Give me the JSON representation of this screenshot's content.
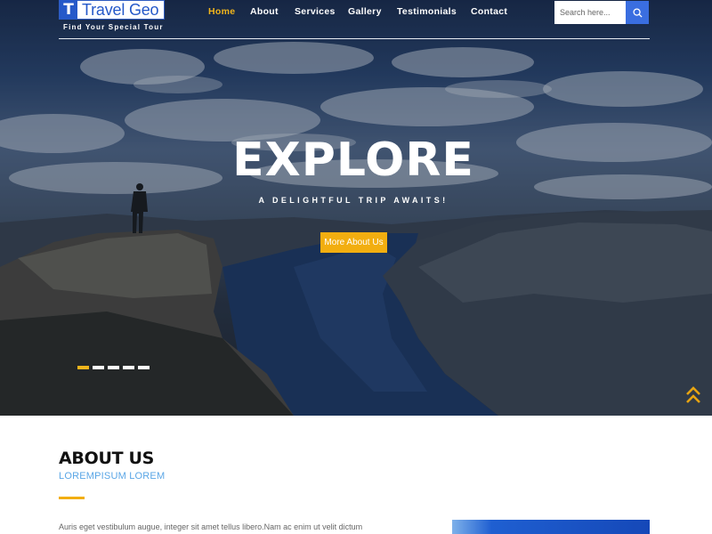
{
  "header": {
    "logo_mark": "T",
    "logo_text": "Travel Geo",
    "tagline": "Find Your Special Tour",
    "nav": [
      {
        "label": "Home",
        "active": true
      },
      {
        "label": "About"
      },
      {
        "label": "Services"
      },
      {
        "label": "Gallery"
      },
      {
        "label": "Testimonials"
      },
      {
        "label": "Contact"
      }
    ],
    "search_placeholder": "Search here...",
    "search_icon": "search-icon"
  },
  "hero": {
    "title": "EXPLORE",
    "subtitle": "A DELIGHTFUL TRIP AWAITS!",
    "button_label": "More About Us",
    "slide_count": 5,
    "active_slide": 1
  },
  "about": {
    "title": "ABOUT US",
    "subtitle": "LOREMPISUM LOREM",
    "text": "Auris eget vestibulum augue, integer sit amet tellus libero.Nam ac enim ut velit dictum"
  },
  "colors": {
    "accent": "#f2ae10",
    "brand_blue": "#2559c9",
    "link_blue": "#5aa6e6"
  }
}
